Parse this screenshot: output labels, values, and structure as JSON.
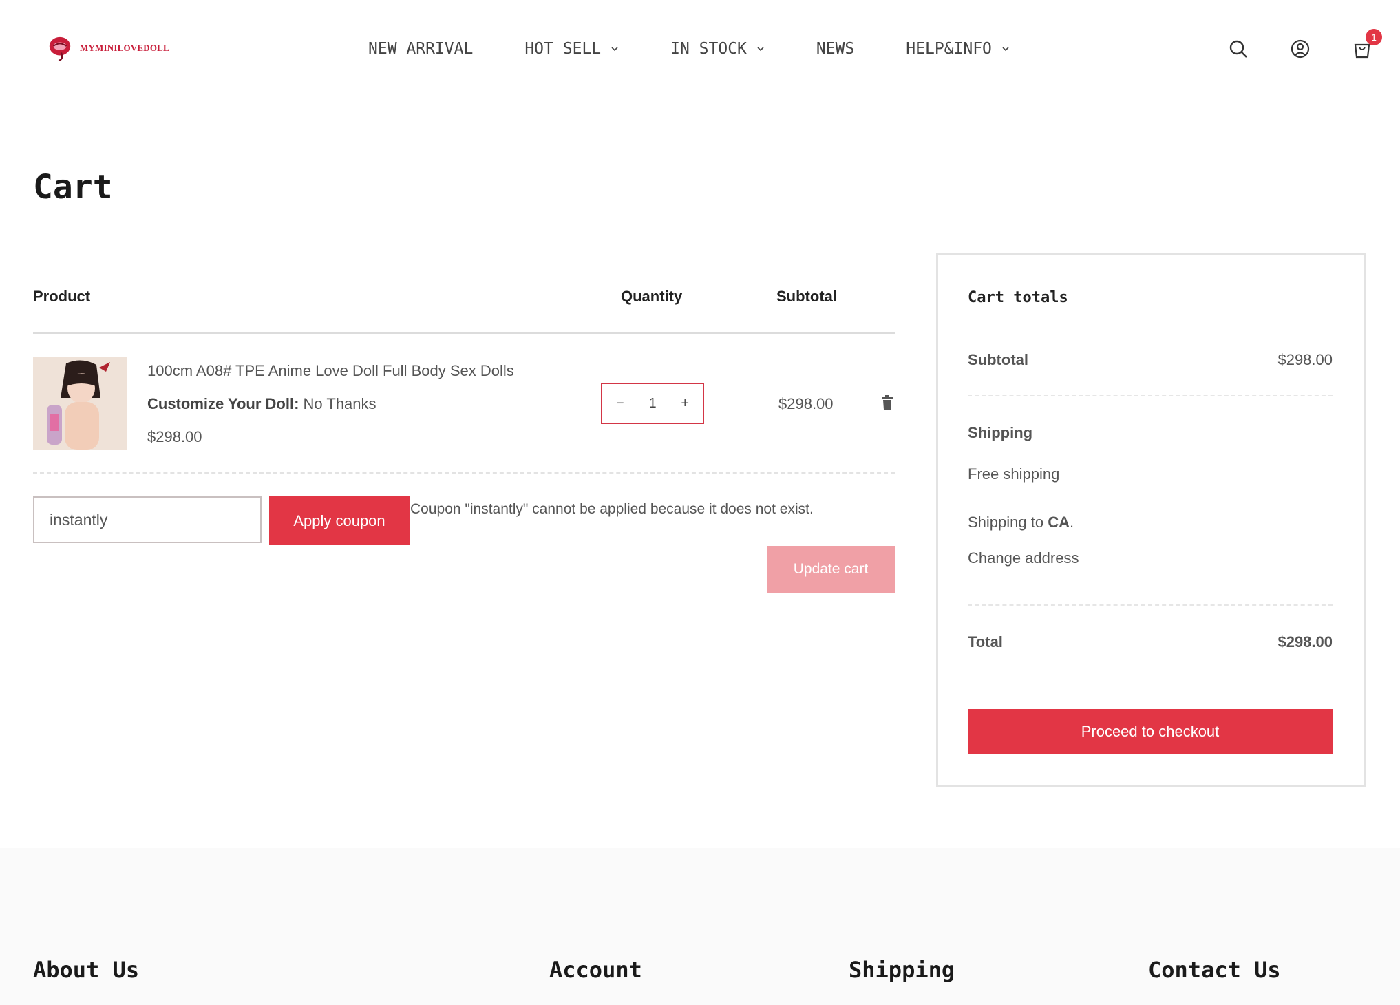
{
  "header": {
    "logo_text": "MYMINILOVEDOLL",
    "nav": [
      {
        "label": "NEW ARRIVAL",
        "has_dropdown": false
      },
      {
        "label": "HOT SELL",
        "has_dropdown": true
      },
      {
        "label": "IN STOCK",
        "has_dropdown": true
      },
      {
        "label": "NEWS",
        "has_dropdown": false
      },
      {
        "label": "HELP&INFO",
        "has_dropdown": true
      }
    ],
    "icons": [
      "search-icon",
      "account-icon",
      "cart-icon"
    ],
    "cart_count": "1"
  },
  "page": {
    "title": "Cart"
  },
  "cart": {
    "columns": {
      "product": "Product",
      "quantity": "Quantity",
      "subtotal": "Subtotal"
    },
    "items": [
      {
        "name": "100cm A08# TPE Anime Love Doll Full Body Sex Dolls",
        "option_label": "Customize Your Doll:",
        "option_value": "No Thanks",
        "price": "$298.00",
        "quantity": "1",
        "subtotal": "$298.00"
      }
    ],
    "coupon_value": "instantly",
    "coupon_button": "Apply coupon",
    "coupon_message": "Coupon \"instantly\" cannot be applied because it does not exist.",
    "update_button": "Update cart"
  },
  "totals": {
    "title": "Cart totals",
    "subtotal_label": "Subtotal",
    "subtotal_value": "$298.00",
    "shipping_label": "Shipping",
    "shipping_method": "Free shipping",
    "shipping_to_prefix": "Shipping to",
    "shipping_to_region": "CA",
    "change_address": "Change address",
    "total_label": "Total",
    "total_value": "$298.00",
    "checkout_button": "Proceed to checkout"
  },
  "footer": {
    "headings": [
      "About Us",
      "Account",
      "Shipping",
      "Contact Us"
    ]
  },
  "colors": {
    "accent": "#e23645",
    "accent_light": "#f0a0a6"
  }
}
